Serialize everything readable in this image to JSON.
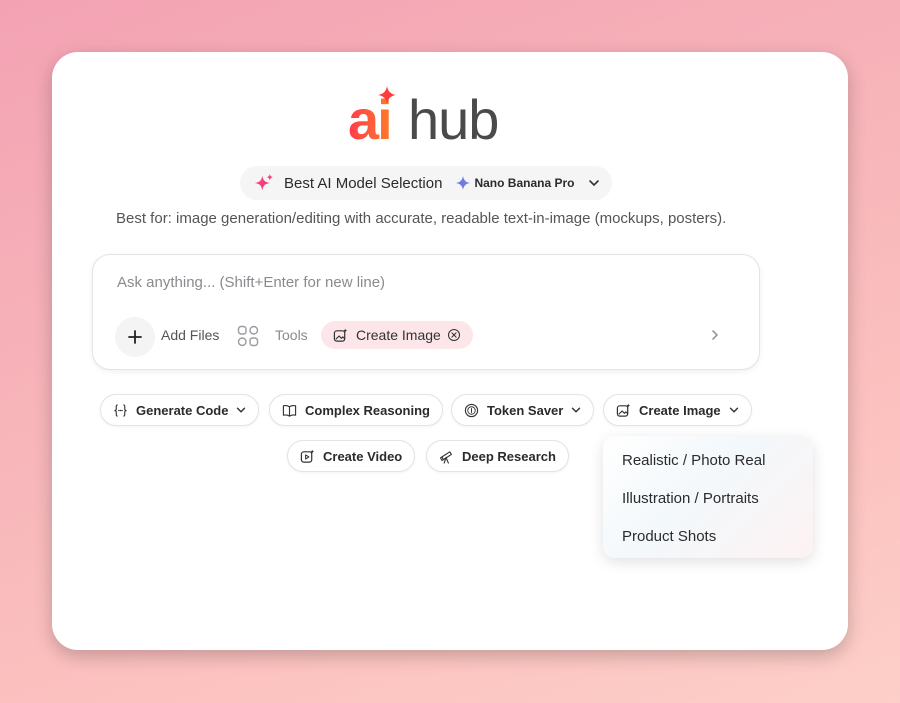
{
  "logo": {
    "prefix": "ai",
    "suffix": "hub"
  },
  "model_selector": {
    "label": "Best AI Model Selection",
    "model": "Nano Banana Pro"
  },
  "best_for": "Best for: image generation/editing with accurate, readable text-in-image (mockups, posters).",
  "input": {
    "placeholder": "Ask anything... (Shift+Enter for new line)",
    "value": ""
  },
  "toolbar": {
    "add_files": "Add Files",
    "tools": "Tools",
    "active_tool": "Create Image"
  },
  "quick_actions": [
    {
      "label": "Generate Code",
      "icon": "code-braces-icon",
      "has_dropdown": true
    },
    {
      "label": "Complex Reasoning",
      "icon": "book-icon",
      "has_dropdown": false
    },
    {
      "label": "Token Saver",
      "icon": "coin-icon",
      "has_dropdown": true
    },
    {
      "label": "Create Image",
      "icon": "image-sparkle-icon",
      "has_dropdown": true
    },
    {
      "label": "Create Video",
      "icon": "video-icon",
      "has_dropdown": false
    },
    {
      "label": "Deep Research",
      "icon": "telescope-icon",
      "has_dropdown": false
    }
  ],
  "image_menu": [
    "Realistic / Photo Real",
    "Illustration / Portraits",
    "Product Shots"
  ],
  "colors": {
    "brand_gradient_start": "#ff3b4f",
    "brand_gradient_end": "#ff7a2a",
    "active_chip_bg": "#fde6ea"
  }
}
